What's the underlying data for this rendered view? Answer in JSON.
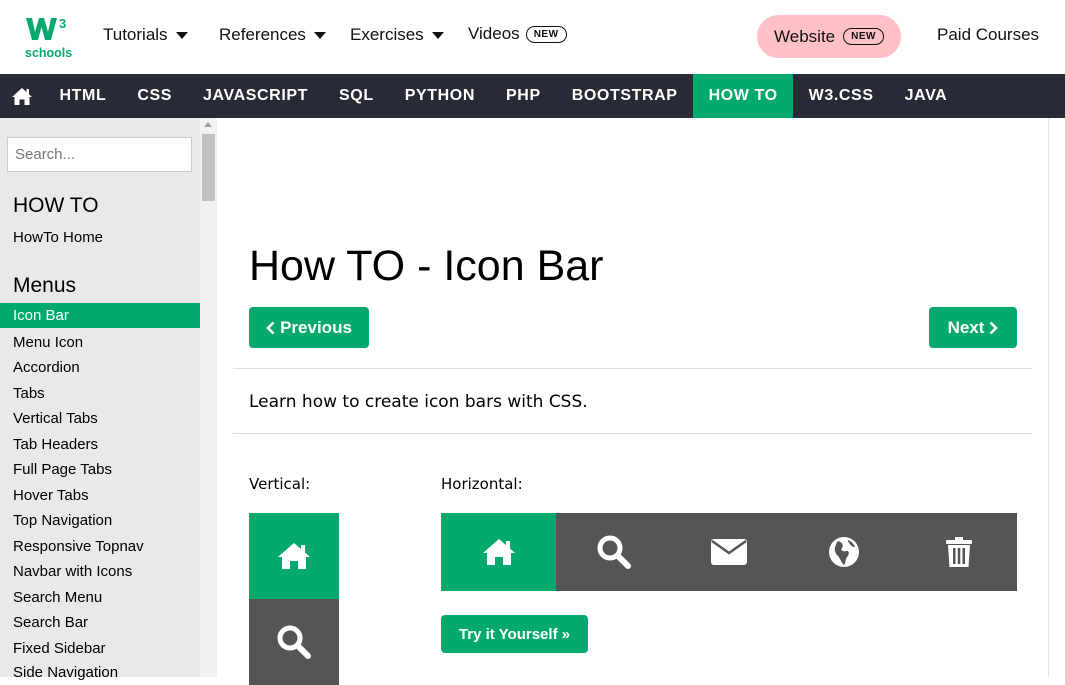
{
  "header": {
    "logo": {
      "sup": "3",
      "text": "schools"
    },
    "nav": [
      {
        "label": "Tutorials",
        "dropdown": true
      },
      {
        "label": "References",
        "dropdown": true
      },
      {
        "label": "Exercises",
        "dropdown": true
      },
      {
        "label": "Videos",
        "badge": "NEW"
      }
    ],
    "website": {
      "label": "Website",
      "badge": "NEW"
    },
    "paid_courses": "Paid Courses"
  },
  "topnav": {
    "items": [
      "HTML",
      "CSS",
      "JAVASCRIPT",
      "SQL",
      "PYTHON",
      "PHP",
      "BOOTSTRAP",
      "HOW TO",
      "W3.CSS",
      "JAVA"
    ],
    "active": "HOW TO"
  },
  "sidebar": {
    "search_placeholder": "Search...",
    "heading1": "HOW TO",
    "home_link": "HowTo Home",
    "heading2": "Menus",
    "active_item": "Icon Bar",
    "items": [
      "Menu Icon",
      "Accordion",
      "Tabs",
      "Vertical Tabs",
      "Tab Headers",
      "Full Page Tabs",
      "Hover Tabs",
      "Top Navigation",
      "Responsive Topnav",
      "Navbar with Icons",
      "Search Menu",
      "Search Bar",
      "Fixed Sidebar",
      "Side Navigation"
    ]
  },
  "main": {
    "title": "How TO - Icon Bar",
    "prev_label": "Previous",
    "next_label": "Next",
    "intro": "Learn how to create icon bars with CSS.",
    "vertical_label": "Vertical:",
    "horizontal_label": "Horizontal:",
    "try_label": "Try it Yourself »",
    "horizontal_icons": [
      "home-icon",
      "search-icon",
      "envelope-icon",
      "globe-icon",
      "trash-icon"
    ],
    "vertical_icons": [
      "home-icon",
      "search-icon"
    ]
  },
  "colors": {
    "accent": "#04aa6d",
    "dark_nav": "#282a35",
    "icon_bar_bg": "#555555",
    "sidebar_bg": "#e7e9eb",
    "website_pill": "#ffc0c7"
  }
}
